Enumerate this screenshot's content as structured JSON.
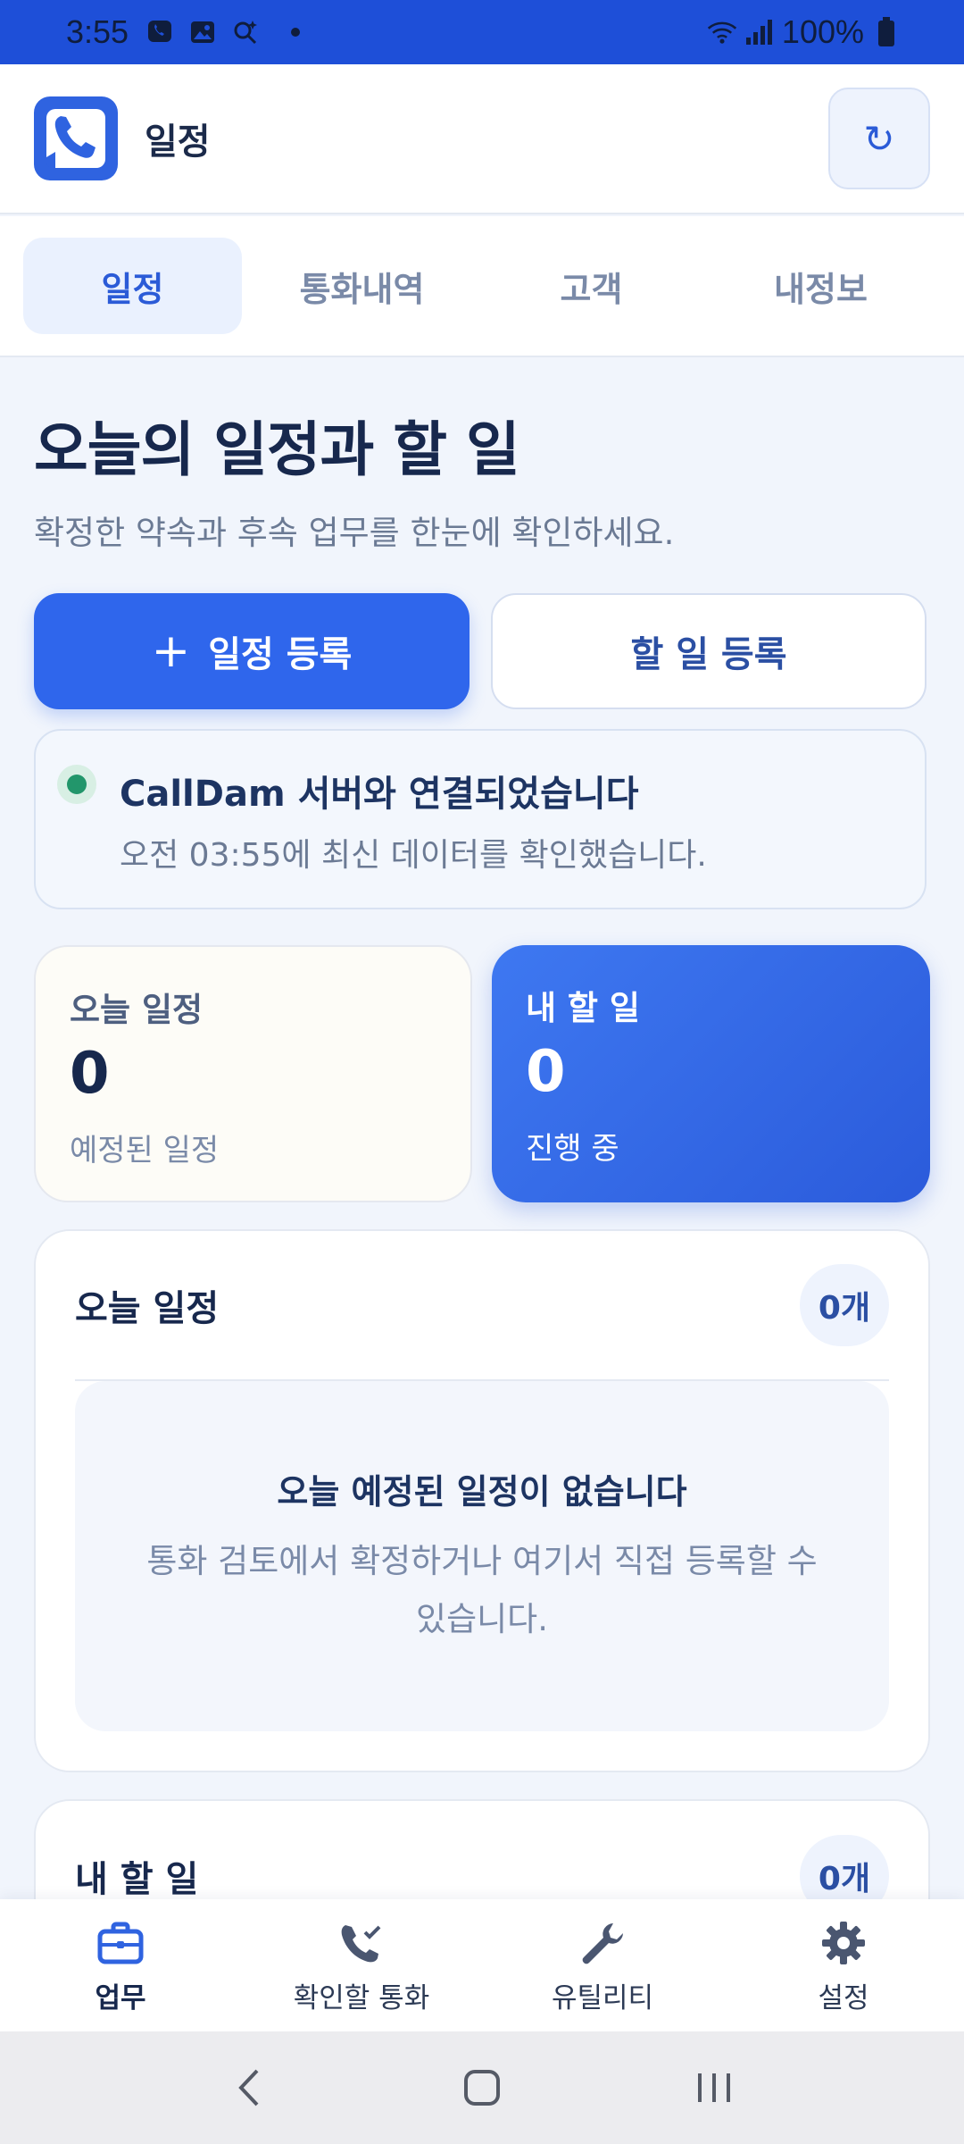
{
  "status_bar": {
    "time": "3:55",
    "battery_text": "100%",
    "icons_left": [
      "phone-chat-icon",
      "gallery-icon",
      "search-sparkle-icon",
      "dot-icon"
    ],
    "icons_right": [
      "wifi-icon",
      "signal-icon",
      "battery-icon"
    ]
  },
  "header": {
    "title": "일정",
    "refresh_icon": "↻"
  },
  "tabs": [
    {
      "label": "일정",
      "active": true
    },
    {
      "label": "통화내역",
      "active": false
    },
    {
      "label": "고객",
      "active": false
    },
    {
      "label": "내정보",
      "active": false
    }
  ],
  "page": {
    "title": "오늘의 일정과 할 일",
    "subtitle": "확정한 약속과 후속 업무를 한눈에 확인하세요."
  },
  "actions": {
    "add_schedule_plus": "+",
    "add_schedule": "일정 등록",
    "add_todo": "할 일 등록"
  },
  "connection": {
    "title": "CallDam 서버와 연결되었습니다",
    "subtitle": "오전 03:55에 최신 데이터를 확인했습니다."
  },
  "stats": {
    "today": {
      "label": "오늘 일정",
      "value": "0",
      "note": "예정된 일정"
    },
    "todo": {
      "label": "내 할 일",
      "value": "0",
      "note": "진행 중"
    }
  },
  "today_section": {
    "title": "오늘 일정",
    "count": "0개",
    "empty_title": "오늘 예정된 일정이 없습니다",
    "empty_sub": "통화 검토에서 확정하거나 여기서 직접 등록할 수 있습니다."
  },
  "todo_section": {
    "title": "내 할 일",
    "count": "0개"
  },
  "bottom_nav": [
    {
      "label": "업무",
      "icon": "briefcase-icon",
      "active": true
    },
    {
      "label": "확인할 통화",
      "icon": "phone-check-icon",
      "active": false
    },
    {
      "label": "유틸리티",
      "icon": "wrench-icon",
      "active": false
    },
    {
      "label": "설정",
      "icon": "gear-icon",
      "active": false
    }
  ],
  "colors": {
    "status_bar": "#1e4fd8",
    "accent": "#2f66ec",
    "connected": "#22966b"
  }
}
